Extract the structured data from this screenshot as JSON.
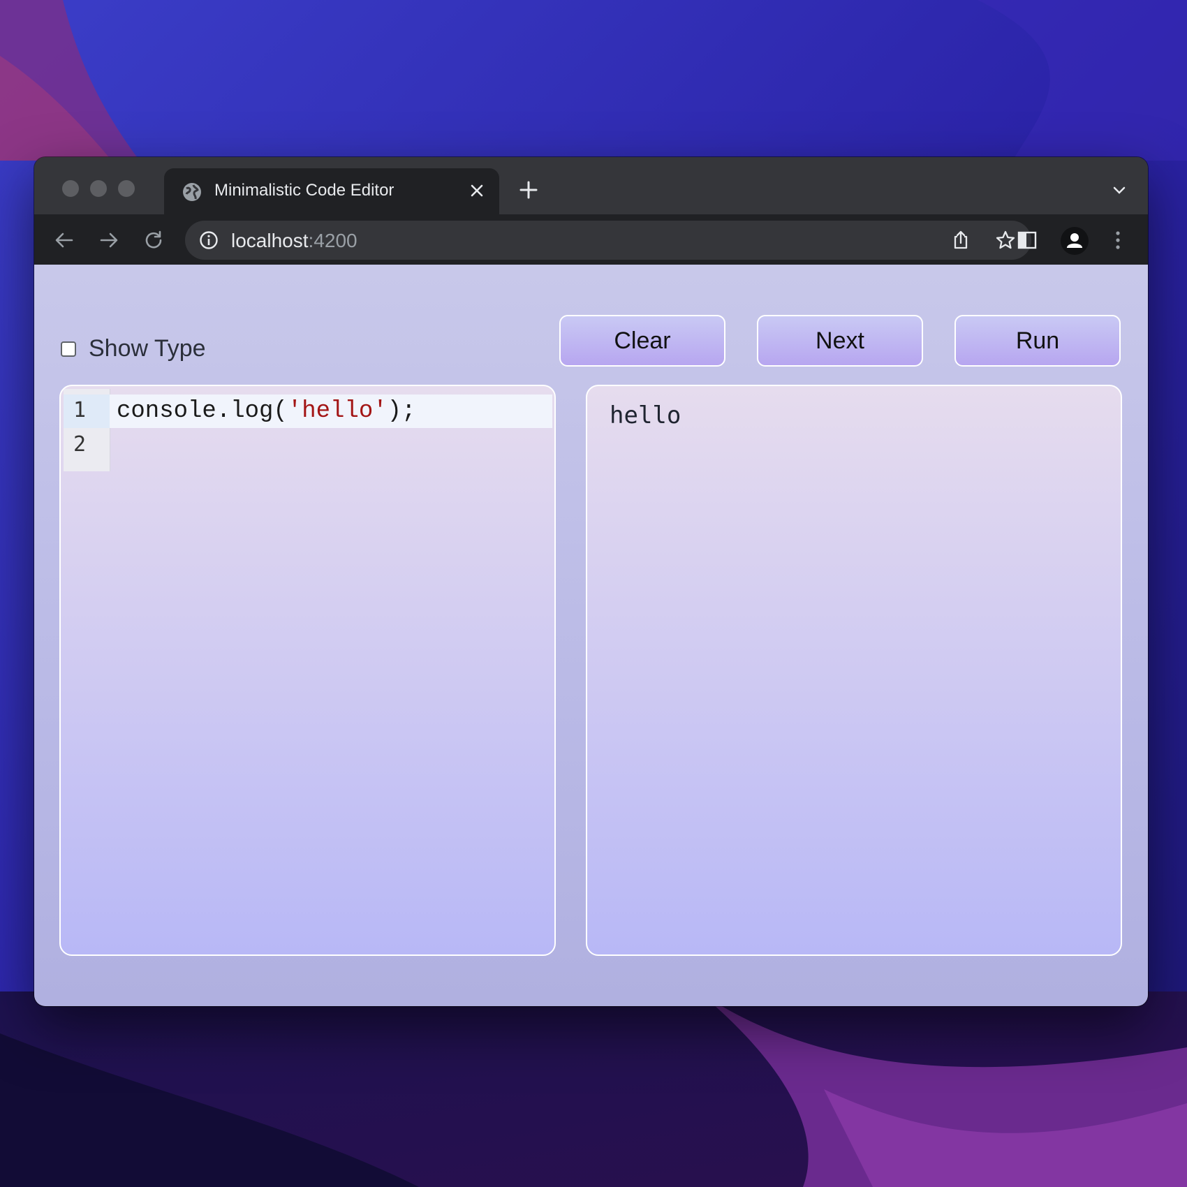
{
  "browser": {
    "tab_title": "Minimalistic Code Editor",
    "url_host": "localhost",
    "url_port": ":4200"
  },
  "app": {
    "show_type_label": "Show Type",
    "show_type_checked": false,
    "buttons": {
      "clear": "Clear",
      "next": "Next",
      "run": "Run"
    },
    "editor": {
      "line_numbers": [
        "1",
        "2"
      ],
      "code_prefix": "console.log(",
      "code_string": "'hello'",
      "code_suffix": ");"
    },
    "output": {
      "text": "hello"
    }
  },
  "colors": {
    "string_literal": "#a31515",
    "button_gradient_top": "#c9c9f4",
    "button_gradient_bottom": "#b7a6f0",
    "page_background": "#c8c8ea"
  },
  "icons": {
    "tab_favicon": "globe-icon",
    "tab_close": "close-icon",
    "new_tab": "plus-icon",
    "tab_search": "chevron-down-icon",
    "back": "arrow-left-icon",
    "forward": "arrow-right-icon",
    "reload": "reload-icon",
    "site_info": "info-icon",
    "share": "share-icon",
    "bookmark": "star-icon",
    "side_panel": "side-panel-icon",
    "profile": "profile-icon",
    "menu": "kebab-menu-icon"
  }
}
